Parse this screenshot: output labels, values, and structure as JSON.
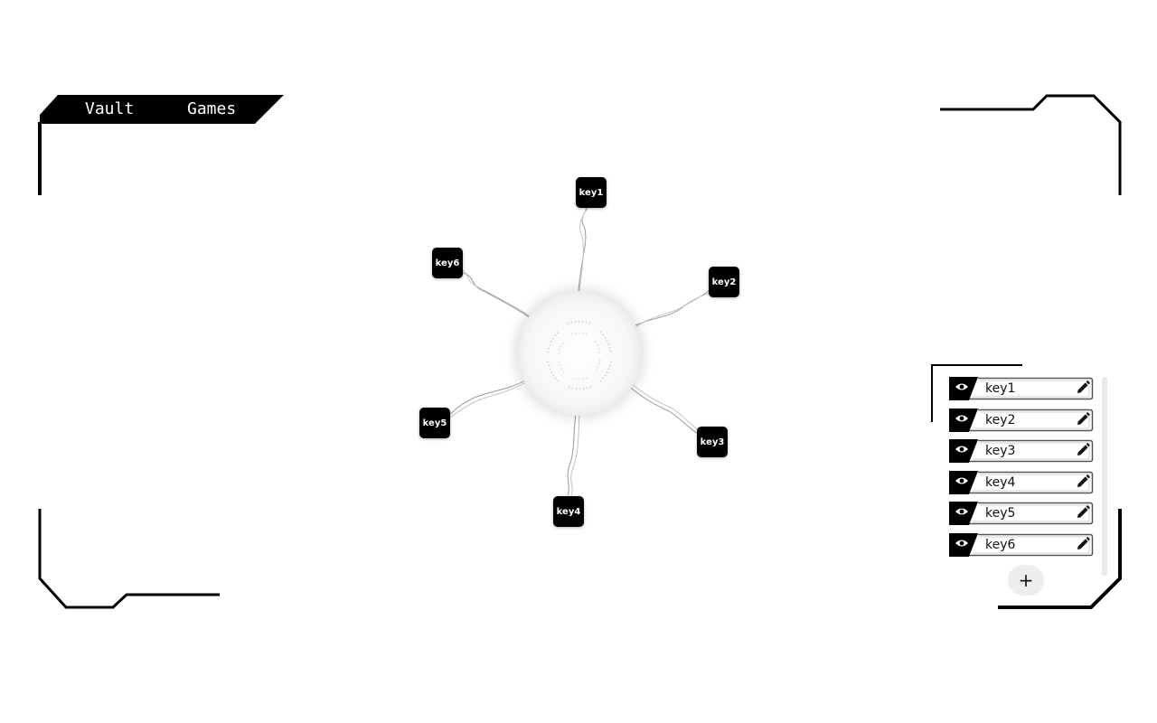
{
  "nav": {
    "vault_label": "Vault",
    "games_label": "Games"
  },
  "graph": {
    "hub_icon": "vault-hub-icon",
    "nodes": [
      {
        "label": "key1"
      },
      {
        "label": "key2"
      },
      {
        "label": "key3"
      },
      {
        "label": "key4"
      },
      {
        "label": "key5"
      },
      {
        "label": "key6"
      }
    ]
  },
  "key_list": {
    "items": [
      {
        "label": "key1",
        "visibility_icon": "eye-icon",
        "edit_icon": "pencil-icon"
      },
      {
        "label": "key2",
        "visibility_icon": "eye-icon",
        "edit_icon": "pencil-icon"
      },
      {
        "label": "key3",
        "visibility_icon": "eye-icon",
        "edit_icon": "pencil-icon"
      },
      {
        "label": "key4",
        "visibility_icon": "eye-icon",
        "edit_icon": "pencil-icon"
      },
      {
        "label": "key5",
        "visibility_icon": "eye-icon",
        "edit_icon": "pencil-icon"
      },
      {
        "label": "key6",
        "visibility_icon": "eye-icon",
        "edit_icon": "pencil-icon"
      }
    ],
    "add_label": "+"
  },
  "colors": {
    "background": "#ffffff",
    "accent": "#000000",
    "node_text": "#ffffff"
  }
}
